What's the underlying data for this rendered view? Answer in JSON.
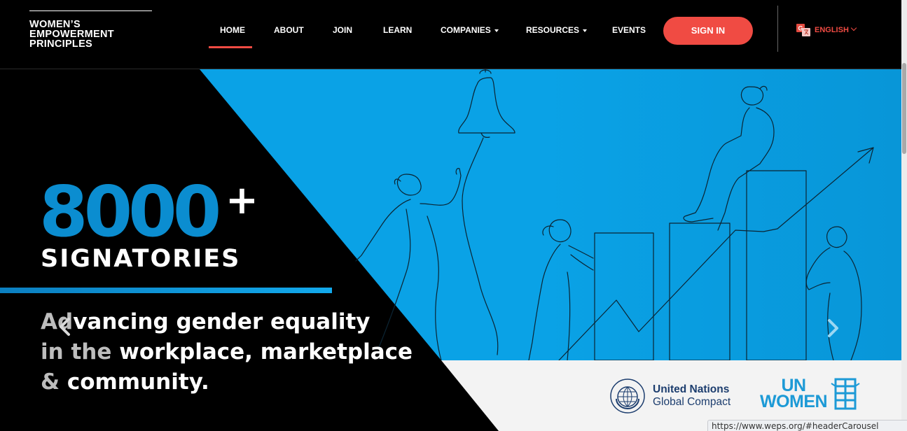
{
  "logo": {
    "lines": [
      "WOMEN’S",
      "EMPOWERMENT",
      "PRINCIPLES"
    ]
  },
  "nav": {
    "items": [
      {
        "label": "HOME",
        "active": true
      },
      {
        "label": "ABOUT"
      },
      {
        "label": "JOIN"
      },
      {
        "label": "LEARN"
      },
      {
        "label": "COMPANIES",
        "dropdown": true
      },
      {
        "label": "RESOURCES",
        "dropdown": true
      },
      {
        "label": "EVENTS"
      }
    ],
    "signin_label": "SIGN IN",
    "language": "ENGLISH"
  },
  "hero": {
    "stat": "8000",
    "stat_suffix": "+",
    "stat_label": "SIGNATORIES",
    "tagline": {
      "line1_muted": "Ad",
      "line1_rest": "vancing gender equality",
      "line2_muted": "in the ",
      "line2_rest": "workplace, marketplace",
      "line3_muted": "& ",
      "line3_rest": "community."
    }
  },
  "partners": {
    "ungc_line1": "United Nations",
    "ungc_line2": "Global Compact",
    "unwomen_line1": "UN",
    "unwomen_line2": "WOMEN"
  },
  "status_url": "https://www.weps.org/#headerCarousel",
  "colors": {
    "accent": "#f04b43",
    "hero_blue": "#0aa2e6",
    "stat_blue": "#0b8dd0",
    "un_blue": "#1d9ad6",
    "ungc_navy": "#1c3d6e"
  },
  "icons": [
    "translate-icon",
    "chevron-left-icon",
    "chevron-right-icon",
    "globe-emblem-icon",
    "unwomen-emblem-icon"
  ]
}
